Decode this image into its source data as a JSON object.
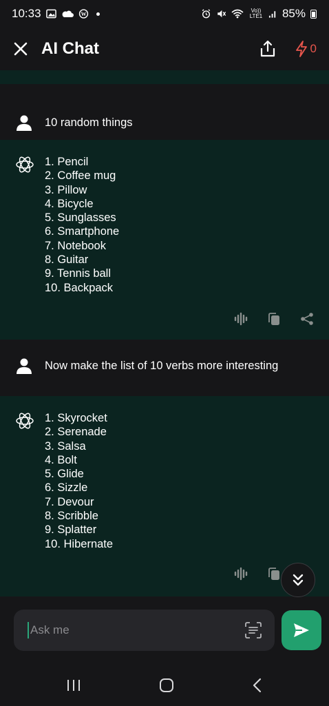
{
  "status": {
    "time": "10:33",
    "network": "Vo)) LTE1",
    "battery": "85%"
  },
  "header": {
    "title": "AI Chat",
    "credits": "0"
  },
  "messages": [
    {
      "role": "user",
      "text": "10 random things"
    },
    {
      "role": "ai",
      "items": [
        "1. Pencil",
        "2. Coffee mug",
        "3. Pillow",
        "4. Bicycle",
        "5. Sunglasses",
        "6. Smartphone",
        "7. Notebook",
        "8. Guitar",
        "9. Tennis ball",
        "10. Backpack"
      ]
    },
    {
      "role": "user",
      "text": "Now make the list of 10 verbs more interesting"
    },
    {
      "role": "ai",
      "items": [
        "1. Skyrocket",
        "2. Serenade",
        "3. Salsa",
        "4. Bolt",
        "5. Glide",
        "6. Sizzle",
        "7. Devour",
        "8. Scribble",
        "9. Splatter",
        "10. Hibernate"
      ]
    }
  ],
  "input": {
    "placeholder": "Ask me"
  },
  "colors": {
    "accent": "#22a06e",
    "ai_bg": "#0b2420",
    "bg": "#161618",
    "credit": "#e8564d"
  }
}
